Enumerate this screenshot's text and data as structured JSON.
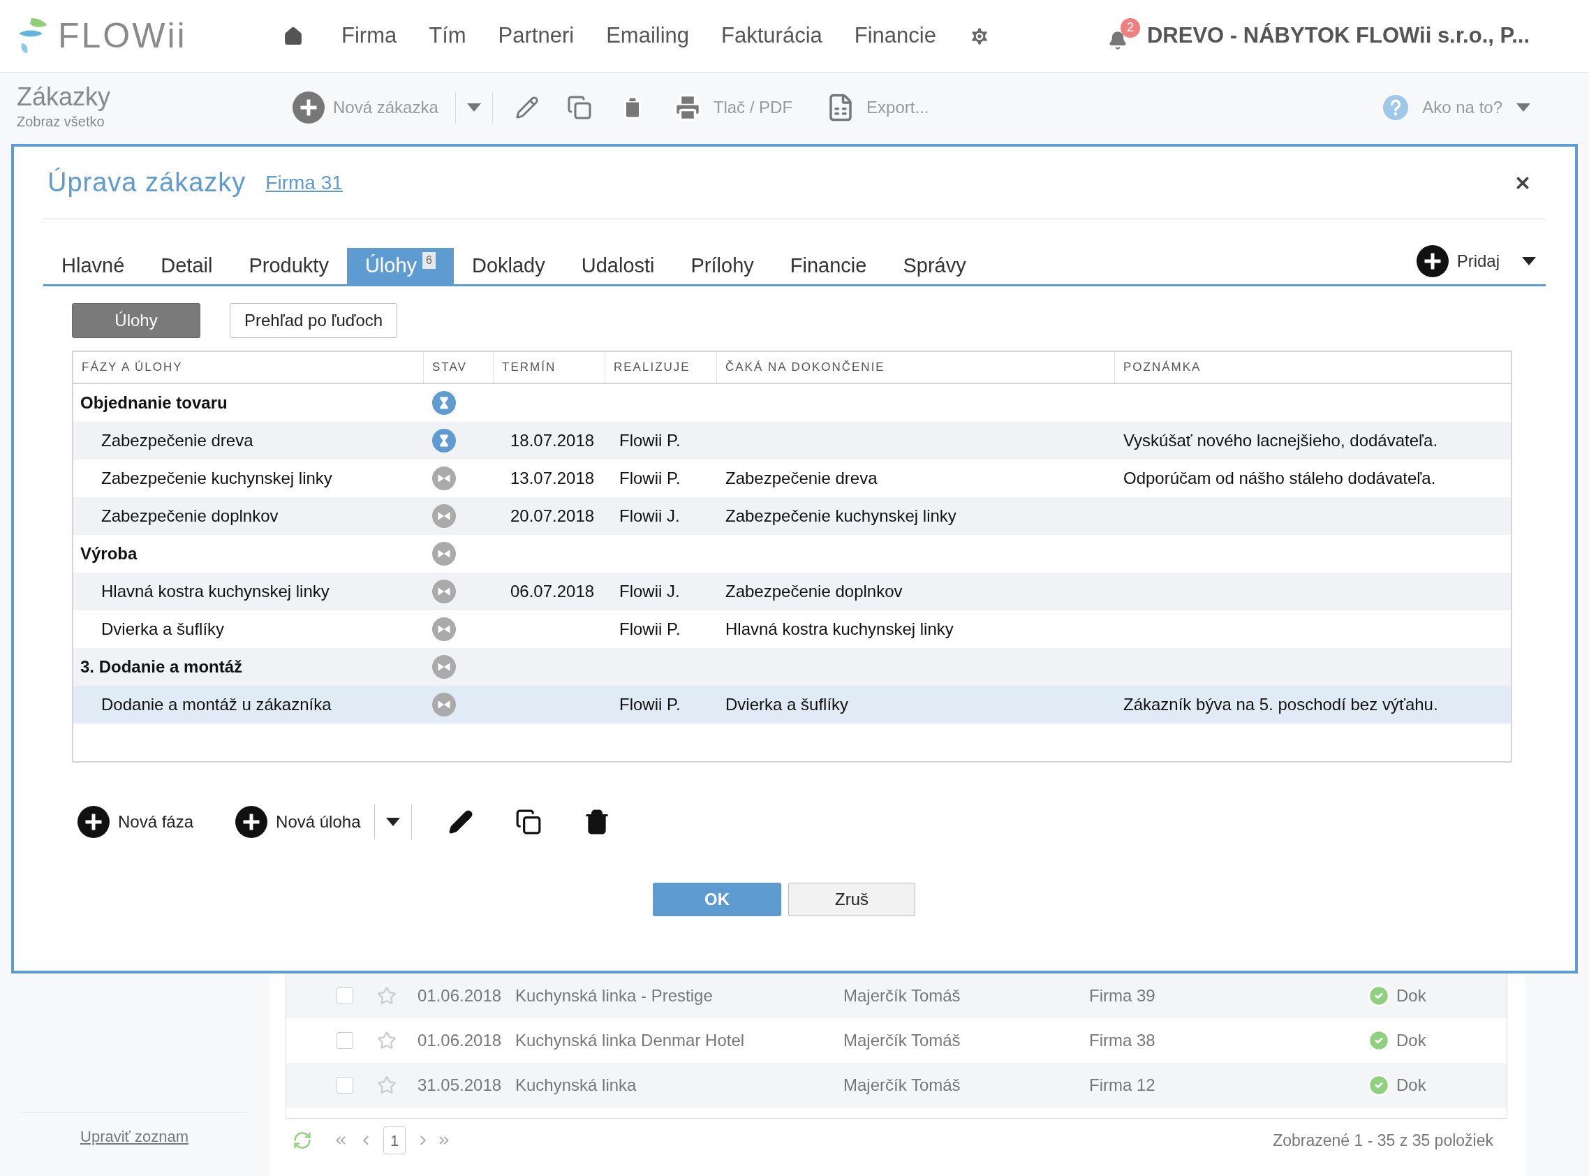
{
  "header": {
    "logo_text": "FLOWii",
    "nav": [
      "Firma",
      "Tím",
      "Partneri",
      "Emailing",
      "Fakturácia",
      "Financie"
    ],
    "notification_count": "2",
    "company": "DREVO - NÁBYTOK FLOWii s.r.o., P..."
  },
  "page": {
    "title": "Zákazky",
    "subtitle": "Zobraz všetko",
    "toolbar": {
      "new": "Nová zákazka",
      "print": "Tlač / PDF",
      "export": "Export...",
      "help": "Ako na to?"
    }
  },
  "modal": {
    "title": "Úprava zákazky",
    "link": "Firma 31",
    "tabs": [
      {
        "label": "Hlavné",
        "selected": false
      },
      {
        "label": "Detail",
        "selected": false
      },
      {
        "label": "Produkty",
        "selected": false
      },
      {
        "label": "Úlohy",
        "selected": true,
        "badge": "6"
      },
      {
        "label": "Doklady",
        "selected": false
      },
      {
        "label": "Udalosti",
        "selected": false
      },
      {
        "label": "Prílohy",
        "selected": false
      },
      {
        "label": "Financie",
        "selected": false
      },
      {
        "label": "Správy",
        "selected": false
      }
    ],
    "add_button": "Pridaj",
    "view_buttons": [
      {
        "label": "Úlohy",
        "selected": true
      },
      {
        "label": "Prehľad po ľuďoch",
        "selected": false
      }
    ],
    "table": {
      "columns": [
        "FÁZY A ÚLOHY",
        "STAV",
        "TERMÍN",
        "REALIZUJE",
        "ČAKÁ NA DOKONČENIE",
        "POZNÁMKA"
      ],
      "rows": [
        {
          "name": "Objednanie tovaru",
          "kind": "in_progress",
          "selected": false,
          "children": [
            {
              "name": "Zabezpečenie dreva",
              "kind": "in_progress",
              "date": "18.07.2018",
              "assignee": "Flowii P.",
              "note": "Vyskúšať nového lacnejšieho, dodávateľa.",
              "selected": false
            },
            {
              "name": "Zabezpečenie kuchynskej linky",
              "kind": "waiting",
              "date": "13.07.2018",
              "assignee": "Flowii P.",
              "waiting_on": "Zabezpečenie dreva",
              "note": "Odporúčam od nášho stáleho dodávateľa.",
              "selected": false
            },
            {
              "name": "Zabezpečenie doplnkov",
              "kind": "waiting",
              "date": "20.07.2018",
              "assignee": "Flowii J.",
              "waiting_on": "Zabezpečenie kuchynskej linky",
              "selected": false
            }
          ]
        },
        {
          "name": "Výroba",
          "kind": "waiting",
          "selected": false,
          "children": [
            {
              "name": "Hlavná kostra kuchynskej linky",
              "kind": "waiting",
              "date": "06.07.2018",
              "assignee": "Flowii J.",
              "waiting_on": "Zabezpečenie doplnkov",
              "selected": false
            },
            {
              "name": "Dvierka a šuflíky",
              "kind": "waiting",
              "assignee": "Flowii P.",
              "waiting_on": "Hlavná kostra kuchynskej linky",
              "selected": false
            }
          ]
        },
        {
          "name": "3. Dodanie a montáž",
          "kind": "waiting",
          "selected": false,
          "children": [
            {
              "name": "Dodanie a montáž u zákazníka",
              "kind": "waiting",
              "assignee": "Flowii P.",
              "waiting_on": "Dvierka a šuflíky",
              "note": "Zákazník býva na 5. poschodí bez výťahu.",
              "selected": true
            }
          ]
        }
      ]
    },
    "bottom_toolbar": {
      "new_phase": "Nová fáza",
      "new_task": "Nová úloha"
    },
    "ok": "OK",
    "cancel": "Zruš"
  },
  "list": {
    "rows": [
      {
        "checked": false,
        "starred": false,
        "date": "01.06.2018",
        "name": "Kuchynská linka - Prestige",
        "owner": "Majerčík Tomáš",
        "company": "Firma 39",
        "done": true,
        "status": "Dok"
      },
      {
        "checked": false,
        "starred": false,
        "date": "01.06.2018",
        "name": "Kuchynská linka Denmar Hotel",
        "owner": "Majerčík Tomáš",
        "company": "Firma 38",
        "done": true,
        "status": "Dok"
      },
      {
        "checked": false,
        "starred": false,
        "date": "31.05.2018",
        "name": "Kuchynská linka",
        "owner": "Majerčík Tomáš",
        "company": "Firma 12",
        "done": true,
        "status": "Dok"
      }
    ],
    "page": "1",
    "summary": "Zobrazené 1 - 35 z 35 položiek"
  },
  "sidebar": {
    "edit_link": "Upraviť zoznam"
  }
}
